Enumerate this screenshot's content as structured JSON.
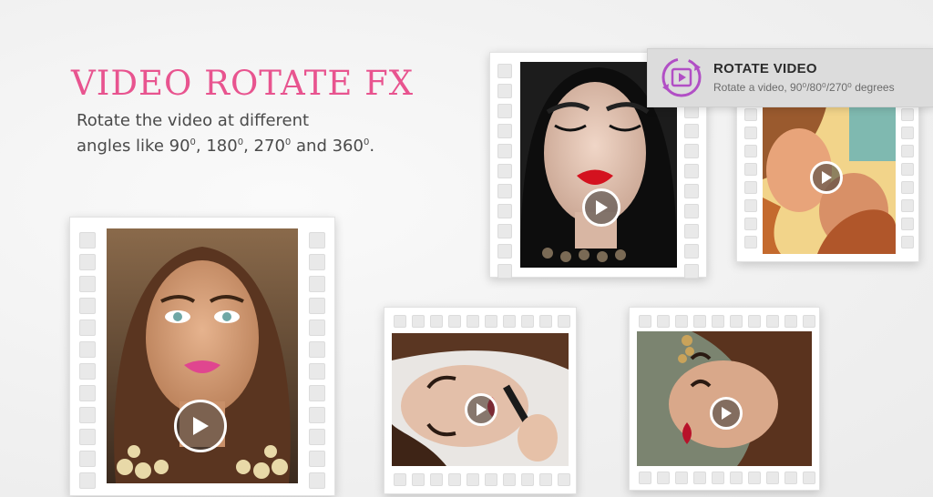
{
  "hero": {
    "title": "VIDEO ROTATE FX",
    "subtitle_line1": "Rotate the video at different",
    "subtitle_line2_prefix": "angles like 90",
    "subtitle_line2_sep1": ", 180",
    "subtitle_line2_sep2": ", 270",
    "subtitle_line2_sep3": " and 360",
    "subtitle_line2_end": ".",
    "degree_mark": "0"
  },
  "tooltip": {
    "title": "ROTATE VIDEO",
    "description": "Rotate a video, 90⁰/80⁰/270⁰ degrees",
    "icon": "rotate-video-icon"
  },
  "thumbnails": [
    {
      "id": "large-portrait",
      "orientation": "vertical",
      "icon": "play-icon"
    },
    {
      "id": "top-portrait",
      "orientation": "vertical",
      "icon": "play-icon"
    },
    {
      "id": "right-rotated",
      "orientation": "vertical",
      "icon": "play-icon"
    },
    {
      "id": "bottom-left-rotated",
      "orientation": "horizontal",
      "icon": "play-icon"
    },
    {
      "id": "bottom-right-rotated",
      "orientation": "horizontal",
      "icon": "play-icon"
    }
  ],
  "colors": {
    "accent_pink": "#e8548f",
    "tooltip_icon_purple": "#b14fc5"
  }
}
